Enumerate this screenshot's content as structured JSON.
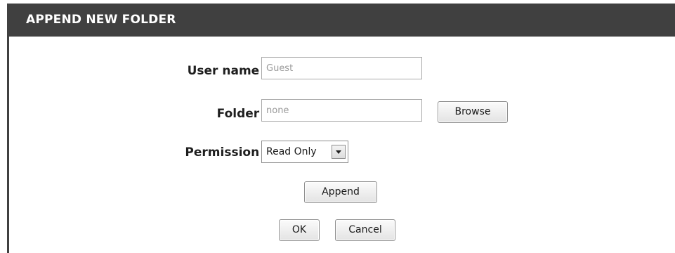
{
  "header": {
    "title": "APPEND NEW FOLDER"
  },
  "form": {
    "user_name": {
      "label": "User name",
      "value": "Guest"
    },
    "folder": {
      "label": "Folder",
      "value": "none",
      "browse_label": "Browse"
    },
    "permission": {
      "label": "Permission",
      "selected": "Read Only"
    },
    "colon": ":",
    "append_label": "Append",
    "ok_label": "OK",
    "cancel_label": "Cancel"
  },
  "colors": {
    "header_bg": "#404040",
    "header_text": "#ffffff",
    "input_text": "#9a9a9a"
  },
  "icons": {
    "dropdown": "chevron-down-icon"
  }
}
